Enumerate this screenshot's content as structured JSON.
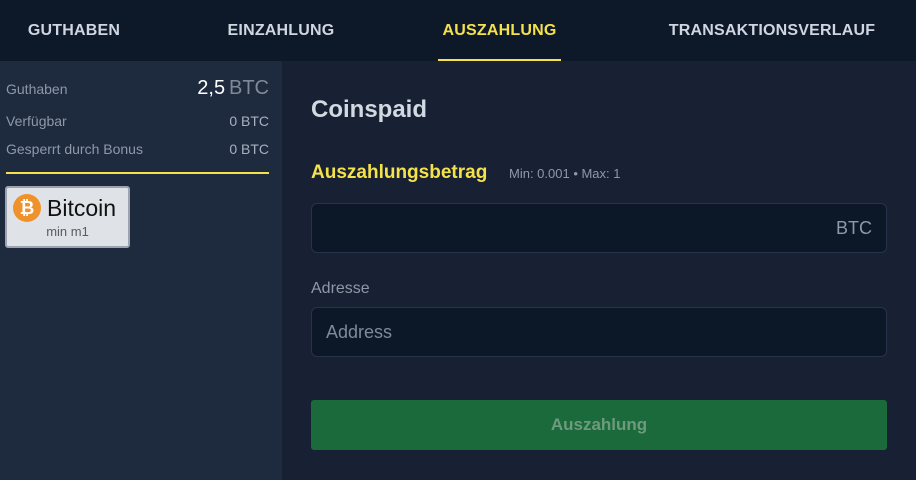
{
  "nav": {
    "tabs": [
      {
        "label": "GUTHABEN",
        "active": false
      },
      {
        "label": "EINZAHLUNG",
        "active": false
      },
      {
        "label": "AUSZAHLUNG",
        "active": true
      },
      {
        "label": "TRANSAKTIONSVERLAUF",
        "active": false
      }
    ]
  },
  "sidebar": {
    "balance": {
      "label": "Guthaben",
      "amount": "2,5",
      "unit": "BTC"
    },
    "available": {
      "label": "Verfügbar",
      "value": "0 BTC"
    },
    "locked": {
      "label": "Gesperrt durch Bonus",
      "value": "0 BTC"
    },
    "method": {
      "icon": "bitcoin-icon",
      "icon_glyph": "₿",
      "name": "Bitcoin",
      "sub": "min m1"
    }
  },
  "main": {
    "title": "Coinspaid",
    "amount": {
      "label": "Auszahlungsbetrag",
      "limits": "Min: 0.001 • Max: 1",
      "value": "",
      "unit": "BTC"
    },
    "address": {
      "label": "Adresse",
      "placeholder": "Address",
      "value": ""
    },
    "submit_label": "Auszahlung"
  },
  "colors": {
    "accent": "#f5e24a",
    "background": "#172133",
    "sidebar": "#1e2a3e",
    "nav": "#0d1829",
    "button": "#1b6a3b",
    "bitcoin": "#f0922b"
  }
}
